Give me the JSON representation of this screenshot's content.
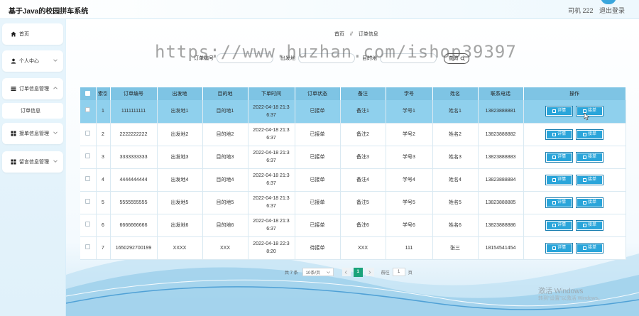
{
  "header": {
    "title": "基于Java的校园拼车系统",
    "user": "司机 222",
    "logout": "退出登录"
  },
  "sidebar": {
    "items": [
      {
        "label": "首页",
        "icon": "home-icon"
      },
      {
        "label": "个人中心",
        "icon": "user-icon"
      },
      {
        "label": "订单信息管理",
        "icon": "list-icon"
      },
      {
        "label": "接单信息管理",
        "icon": "grid-icon"
      },
      {
        "label": "留言信息管理",
        "icon": "grid-icon"
      }
    ],
    "subitem": "订单信息"
  },
  "breadcrumb": {
    "home": "首页",
    "sep": "//",
    "current": "订单信息"
  },
  "search": {
    "label1": "订单编号",
    "label2": "出发地",
    "label3": "目的地",
    "button": "查询"
  },
  "watermark": "https://www.huzhan.com/ishop39397",
  "table": {
    "headers": [
      "",
      "索引",
      "订单编号",
      "出发地",
      "目的地",
      "下单时间",
      "订单状态",
      "备注",
      "学号",
      "姓名",
      "联系电话",
      "操作"
    ],
    "detail_label": "详情",
    "accept_label": "接单",
    "rows": [
      {
        "index": "1",
        "order_no": "1111111111",
        "from": "出发地1",
        "to": "目的地1",
        "time1": "2022-04-18 21:3",
        "time2": "6:37",
        "status": "已接单",
        "remark": "备注1",
        "student_no": "学号1",
        "name": "姓名1",
        "phone": "13823888881"
      },
      {
        "index": "2",
        "order_no": "2222222222",
        "from": "出发地2",
        "to": "目的地2",
        "time1": "2022-04-18 21:3",
        "time2": "6:37",
        "status": "已接单",
        "remark": "备注2",
        "student_no": "学号2",
        "name": "姓名2",
        "phone": "13823888882"
      },
      {
        "index": "3",
        "order_no": "3333333333",
        "from": "出发地3",
        "to": "目的地3",
        "time1": "2022-04-18 21:3",
        "time2": "6:37",
        "status": "已接单",
        "remark": "备注3",
        "student_no": "学号3",
        "name": "姓名3",
        "phone": "13823888883"
      },
      {
        "index": "4",
        "order_no": "4444444444",
        "from": "出发地4",
        "to": "目的地4",
        "time1": "2022-04-18 21:3",
        "time2": "6:37",
        "status": "已接单",
        "remark": "备注4",
        "student_no": "学号4",
        "name": "姓名4",
        "phone": "13823888884"
      },
      {
        "index": "5",
        "order_no": "5555555555",
        "from": "出发地5",
        "to": "目的地5",
        "time1": "2022-04-18 21:3",
        "time2": "6:37",
        "status": "已接单",
        "remark": "备注5",
        "student_no": "学号5",
        "name": "姓名5",
        "phone": "13823888885"
      },
      {
        "index": "6",
        "order_no": "6666666666",
        "from": "出发地6",
        "to": "目的地6",
        "time1": "2022-04-18 21:3",
        "time2": "6:37",
        "status": "已接单",
        "remark": "备注6",
        "student_no": "学号6",
        "name": "姓名6",
        "phone": "13823888886"
      },
      {
        "index": "7",
        "order_no": "1650292700199",
        "from": "XXXX",
        "to": "XXX",
        "time1": "2022-04-18 22:3",
        "time2": "8:20",
        "status": "待接单",
        "remark": "XXX",
        "student_no": "111",
        "name": "张三",
        "phone": "18154541454"
      }
    ]
  },
  "pager": {
    "total": "共 7 条",
    "size": "10条/页",
    "page": "1",
    "goto_label": "前往",
    "goto_value": "1",
    "page_unit": "页"
  },
  "os_watermark": {
    "line1": "激活 Windows",
    "line2": "转到“设置”以激活 Windows。"
  },
  "colors": {
    "header_row": "#7ec4e4",
    "selected_row": "#8fd0ed",
    "button": "#2aa5da",
    "active_page": "#1aa37a"
  }
}
